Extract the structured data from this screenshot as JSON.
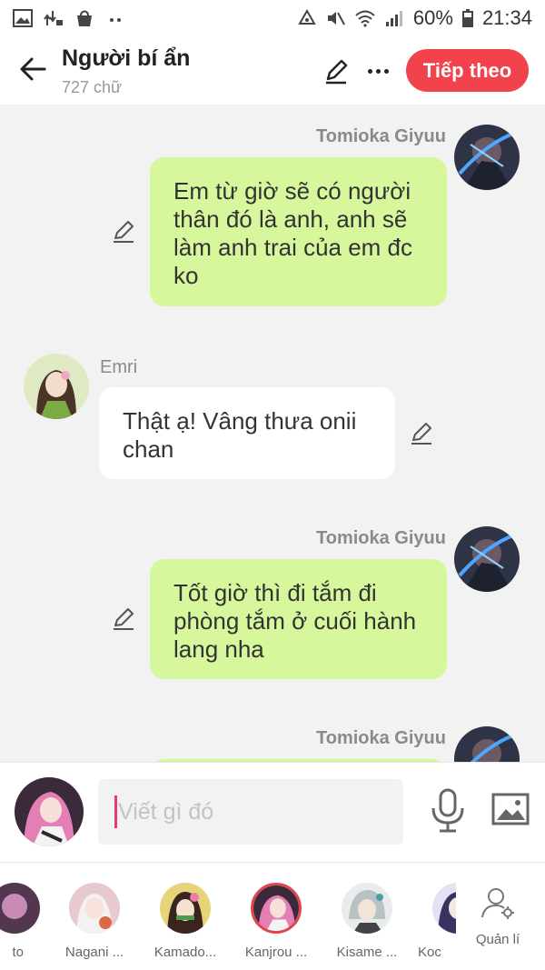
{
  "status_bar": {
    "battery": "60%",
    "time": "21:34",
    "left_icons": [
      "gallery-icon",
      "transfer-icon",
      "bag-icon",
      "dots-icon"
    ],
    "right_icons": [
      "recycle-icon",
      "mute-icon",
      "wifi-icon",
      "signal-icon",
      "battery-icon"
    ]
  },
  "header": {
    "title": "Người bí ẩn",
    "subtitle": "727 chữ",
    "next_label": "Tiếp theo",
    "accent": "#f2424b"
  },
  "messages": [
    {
      "sender": "Tomioka Giyuu",
      "side": "right",
      "text": "Em từ giờ sẽ có người thân đó là anh, anh sẽ làm anh trai của em đc ko"
    },
    {
      "sender": "Emri",
      "side": "left",
      "text": "Thật ạ! Vâng thưa onii chan"
    },
    {
      "sender": "Tomioka Giyuu",
      "side": "right",
      "text": "Tốt giờ thì đi tắm đi phòng tắm ở cuối hành lang nha"
    },
    {
      "sender": "Tomioka Giyuu",
      "side": "right",
      "text": ""
    }
  ],
  "bubble_colors": {
    "green": "#d6f79b",
    "white": "#ffffff"
  },
  "composer": {
    "placeholder": "Viết gì đó",
    "value": ""
  },
  "characters": [
    {
      "name": "to",
      "selected": false
    },
    {
      "name": "Nagani ...",
      "selected": false
    },
    {
      "name": "Kamado...",
      "selected": false
    },
    {
      "name": "Kanjrou ...",
      "selected": true
    },
    {
      "name": "Kisame ...",
      "selected": false
    },
    {
      "name": "Koc",
      "selected": false
    }
  ],
  "manage_label": "Quản lí"
}
